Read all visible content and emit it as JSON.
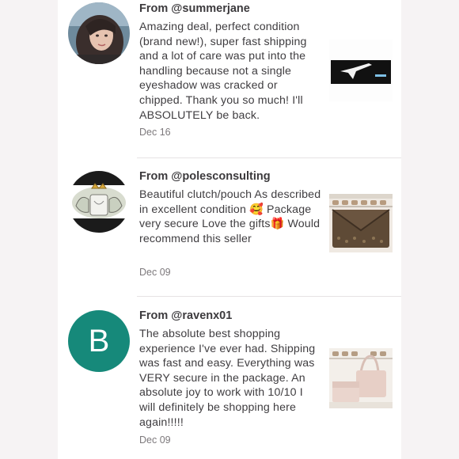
{
  "reviews": [
    {
      "author": "From @summerjane",
      "body": "Amazing deal, perfect condition (brand new!), super fast shipping and a lot of care was put into the handling because not a single eyeshadow was cracked or chipped. Thank you so much! I'll ABSOLUTELY be back.",
      "date": "Dec 16"
    },
    {
      "author": "From @polesconsulting",
      "body": "Beautiful clutch/pouch As described in excellent condition 🥰 Package very secure Love the gifts🎁 Would recommend this seller",
      "date": "Dec 09"
    },
    {
      "author": "From @ravenx01",
      "avatar_letter": "B",
      "body": "The absolute best shopping experience I've ever had. Shipping was fast and easy. Everything was VERY secure in the package. An absolute joy to work with 10/10 I will definitely be shopping here again!!!!!",
      "date": "Dec 09"
    }
  ],
  "colors": {
    "background": "#f6f3f4",
    "card": "#ffffff",
    "letter_avatar": "#16897a",
    "text": "#3f3d40",
    "muted": "#7d797c"
  }
}
